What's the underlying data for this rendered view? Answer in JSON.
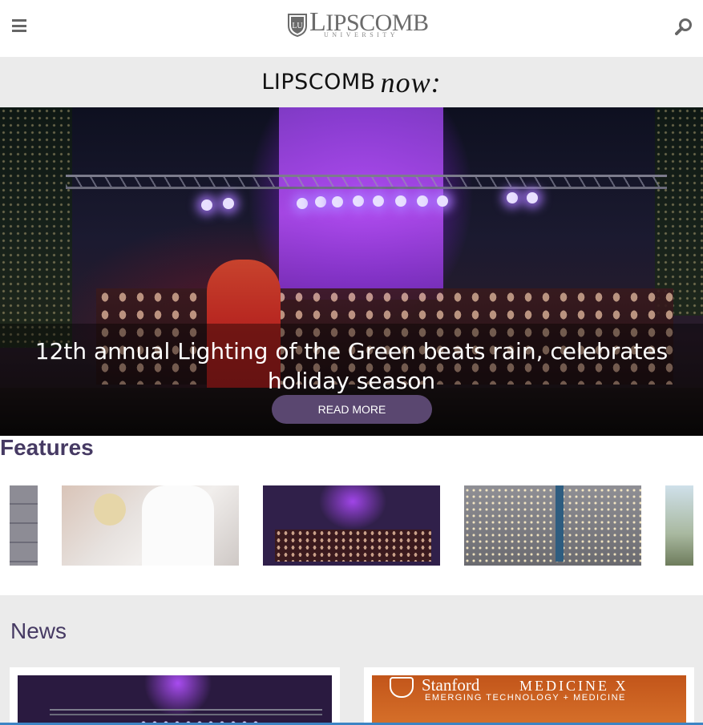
{
  "header": {
    "menu_icon": "hamburger-menu-icon",
    "logo": {
      "word": "IPSCOMB",
      "initial": "L",
      "sub": "UNIVERSITY"
    },
    "search_icon": "search-icon"
  },
  "brand_band": {
    "word": "LIPSCOMB",
    "italic": "now:"
  },
  "hero": {
    "title": "12th annual Lighting of the Green beats rain, celebrates holiday season",
    "button": "READ MORE"
  },
  "features": {
    "title": "Features",
    "items": [
      {
        "name": "feature-partial-left"
      },
      {
        "name": "feature-medical-exam"
      },
      {
        "name": "feature-lighting-green"
      },
      {
        "name": "feature-campus-lights"
      },
      {
        "name": "feature-partial-right"
      }
    ]
  },
  "news": {
    "title": "News",
    "cards": [
      {
        "name": "news-card-lighting"
      },
      {
        "name": "news-card-stanford",
        "stanford": "Stanford",
        "medicine": "MEDICINE X",
        "tagline": "EMERGING TECHNOLOGY + MEDICINE"
      }
    ]
  },
  "colors": {
    "accent": "#463a63",
    "button": "#5a4770",
    "band": "#ebebeb",
    "link_bar": "#3c84c4"
  }
}
